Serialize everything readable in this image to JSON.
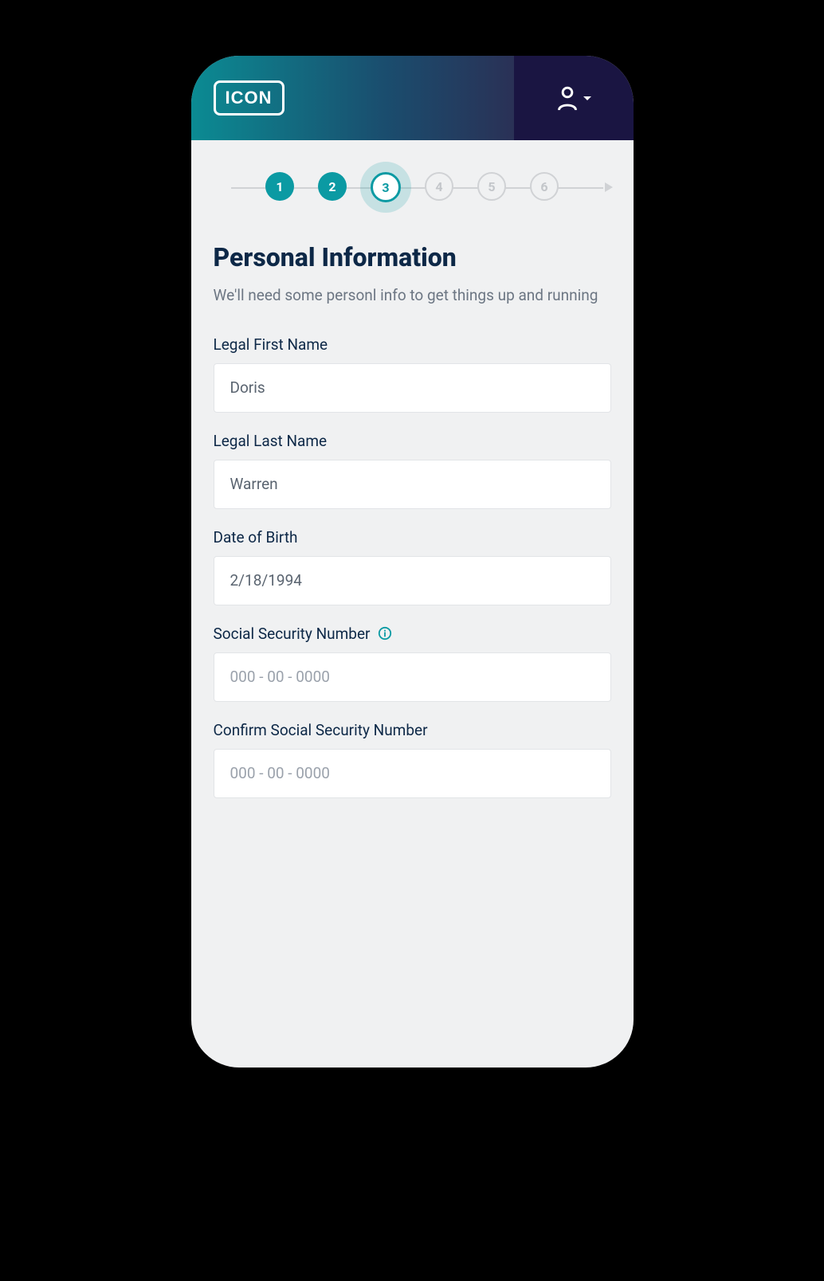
{
  "header": {
    "logo_text": "ICON"
  },
  "stepper": {
    "steps": [
      {
        "num": "1",
        "state": "done"
      },
      {
        "num": "2",
        "state": "done"
      },
      {
        "num": "3",
        "state": "current"
      },
      {
        "num": "4",
        "state": "upcoming"
      },
      {
        "num": "5",
        "state": "upcoming"
      },
      {
        "num": "6",
        "state": "upcoming"
      }
    ]
  },
  "page": {
    "title": "Personal Information",
    "subtitle": "We'll need some personl info to get things up and running"
  },
  "form": {
    "first_name": {
      "label": "Legal First Name",
      "value": "Doris"
    },
    "last_name": {
      "label": "Legal Last Name",
      "value": "Warren"
    },
    "dob": {
      "label": "Date of Birth",
      "value": "2/18/1994"
    },
    "ssn": {
      "label": "Social Security Number",
      "placeholder": "000 - 00 - 0000",
      "value": ""
    },
    "ssn_confirm": {
      "label": "Confirm Social Security Number",
      "placeholder": "000 - 00 - 0000",
      "value": ""
    }
  }
}
